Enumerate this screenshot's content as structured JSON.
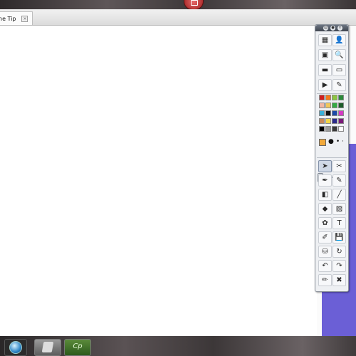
{
  "window": {
    "tab_label": "ne Tip",
    "tab_close": "×"
  },
  "taskbar": {
    "apps": [
      {
        "name": "start-orb"
      },
      {
        "name": "pen-app"
      },
      {
        "name": "captivate-app",
        "label": "Cp"
      }
    ]
  },
  "toolbar": {
    "header_buttons": [
      "▤",
      "●",
      "×"
    ],
    "tools_top": [
      {
        "icon": "desktop-icon",
        "glyph": "▦"
      },
      {
        "icon": "user-icon",
        "glyph": "👤"
      },
      {
        "icon": "image-icon",
        "glyph": "▣"
      },
      {
        "icon": "magnify-icon",
        "glyph": "🔍"
      },
      {
        "icon": "screen-shade-icon",
        "glyph": "▬"
      },
      {
        "icon": "blank-page-icon",
        "glyph": "▭"
      },
      {
        "icon": "play-icon",
        "glyph": "▶"
      },
      {
        "icon": "eraser-icon",
        "glyph": "✎"
      }
    ],
    "palette": [
      "#d11f1f",
      "#f47a1b",
      "#8cc63f",
      "#2a8a3a",
      "#f2b7a0",
      "#f0c75a",
      "#33aa44",
      "#1d5c2a",
      "#3ab0d8",
      "#111111",
      "#1c4aa8",
      "#d43ac4",
      "#c98a5a",
      "#f2d64a",
      "#2a2a8a",
      "#7a1a7a",
      "#000000",
      "#9a9a9a",
      "#3a3a3a",
      "#ffffff"
    ],
    "dot_sizes": [
      "●",
      "•",
      "·"
    ],
    "tools_bottom": [
      {
        "icon": "select-arrow-icon",
        "glyph": "➤",
        "selected": true
      },
      {
        "icon": "crop-icon",
        "glyph": "✂"
      },
      {
        "icon": "pen-icon",
        "glyph": "✒"
      },
      {
        "icon": "highlighter-icon",
        "glyph": "✎"
      },
      {
        "icon": "eraser-tool-icon",
        "glyph": "◧"
      },
      {
        "icon": "line-icon",
        "glyph": "╱"
      },
      {
        "icon": "shape-icon",
        "glyph": "◆"
      },
      {
        "icon": "fill-icon",
        "glyph": "▨"
      },
      {
        "icon": "stamp-icon",
        "glyph": "✿"
      },
      {
        "icon": "text-icon",
        "glyph": "T"
      },
      {
        "icon": "marker-icon",
        "glyph": "✐"
      },
      {
        "icon": "save-icon",
        "glyph": "💾"
      },
      {
        "icon": "spray-icon",
        "glyph": "⛁"
      },
      {
        "icon": "refresh-icon",
        "glyph": "↻"
      },
      {
        "icon": "undo-icon",
        "glyph": "↶"
      },
      {
        "icon": "redo-icon",
        "glyph": "↷"
      },
      {
        "icon": "pencil-icon",
        "glyph": "✏"
      },
      {
        "icon": "delete-icon",
        "glyph": "✖"
      }
    ]
  }
}
